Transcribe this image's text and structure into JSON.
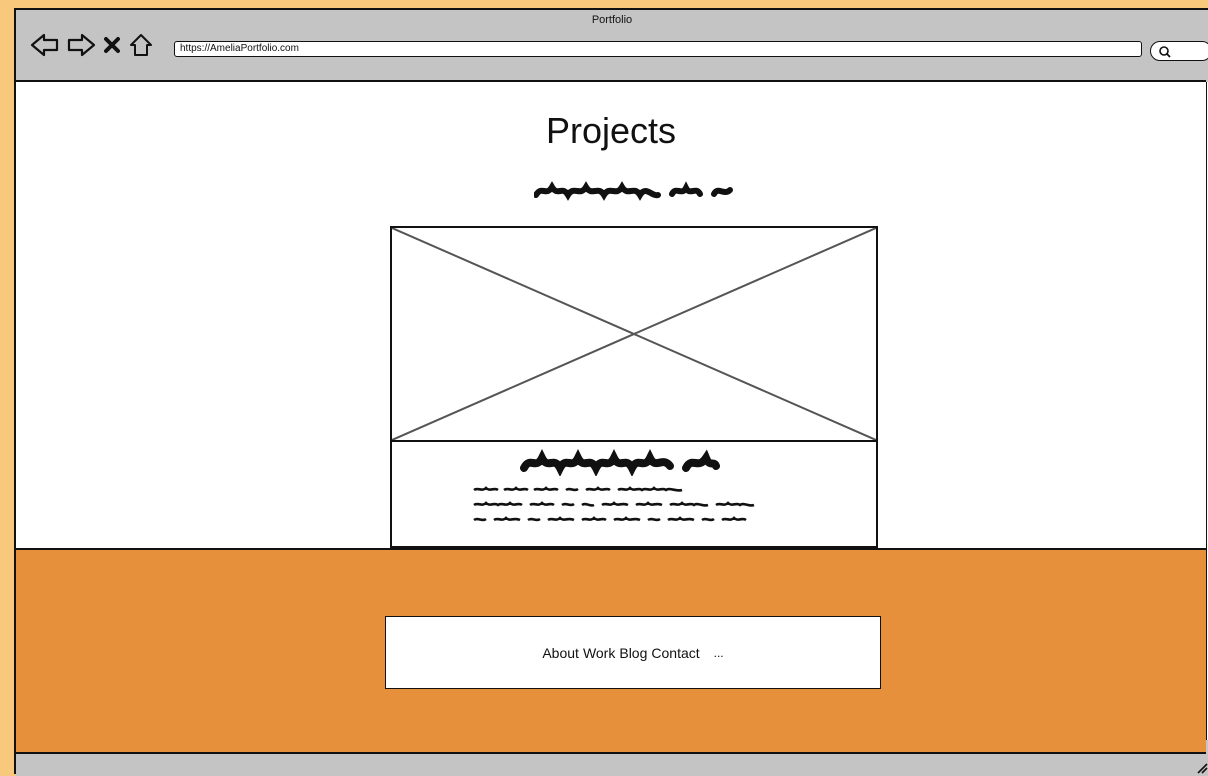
{
  "window": {
    "title": "Portfolio"
  },
  "browser": {
    "url": "https://AmeliaPortfolio.com",
    "icons": [
      "back-arrow-icon",
      "forward-arrow-icon",
      "close-icon",
      "home-icon",
      "search-icon"
    ]
  },
  "page": {
    "title": "Projects"
  },
  "footer": {
    "nav": [
      "About",
      "Work",
      "Blog",
      "Contact"
    ],
    "more": "..."
  },
  "colors": {
    "background": "#f8c97c",
    "chrome": "#c4c4c4",
    "footer": "#e6903b"
  }
}
